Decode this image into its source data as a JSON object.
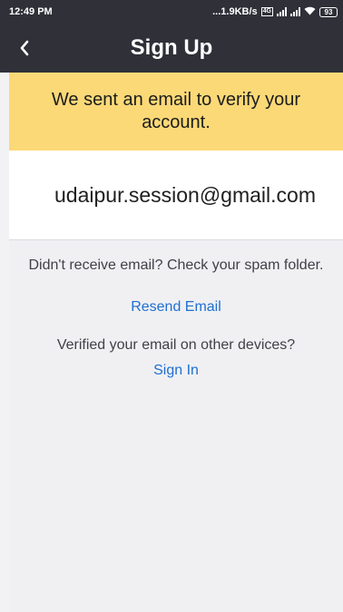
{
  "status_bar": {
    "time": "12:49 PM",
    "net_speed": "...1.9KB/s",
    "volte": "4G",
    "battery": "93"
  },
  "header": {
    "title": "Sign Up"
  },
  "banner": {
    "message": "We sent an email to verify your account."
  },
  "email": {
    "address": "udaipur.session@gmail.com"
  },
  "info": {
    "spam_message": "Didn't receive email? Check your spam folder.",
    "resend_label": "Resend Email",
    "verified_message": "Verified your email on other devices?",
    "signin_label": "Sign In"
  },
  "colors": {
    "header_bg": "#2f3038",
    "banner_bg": "#fbd977",
    "link": "#1f6fcf"
  }
}
